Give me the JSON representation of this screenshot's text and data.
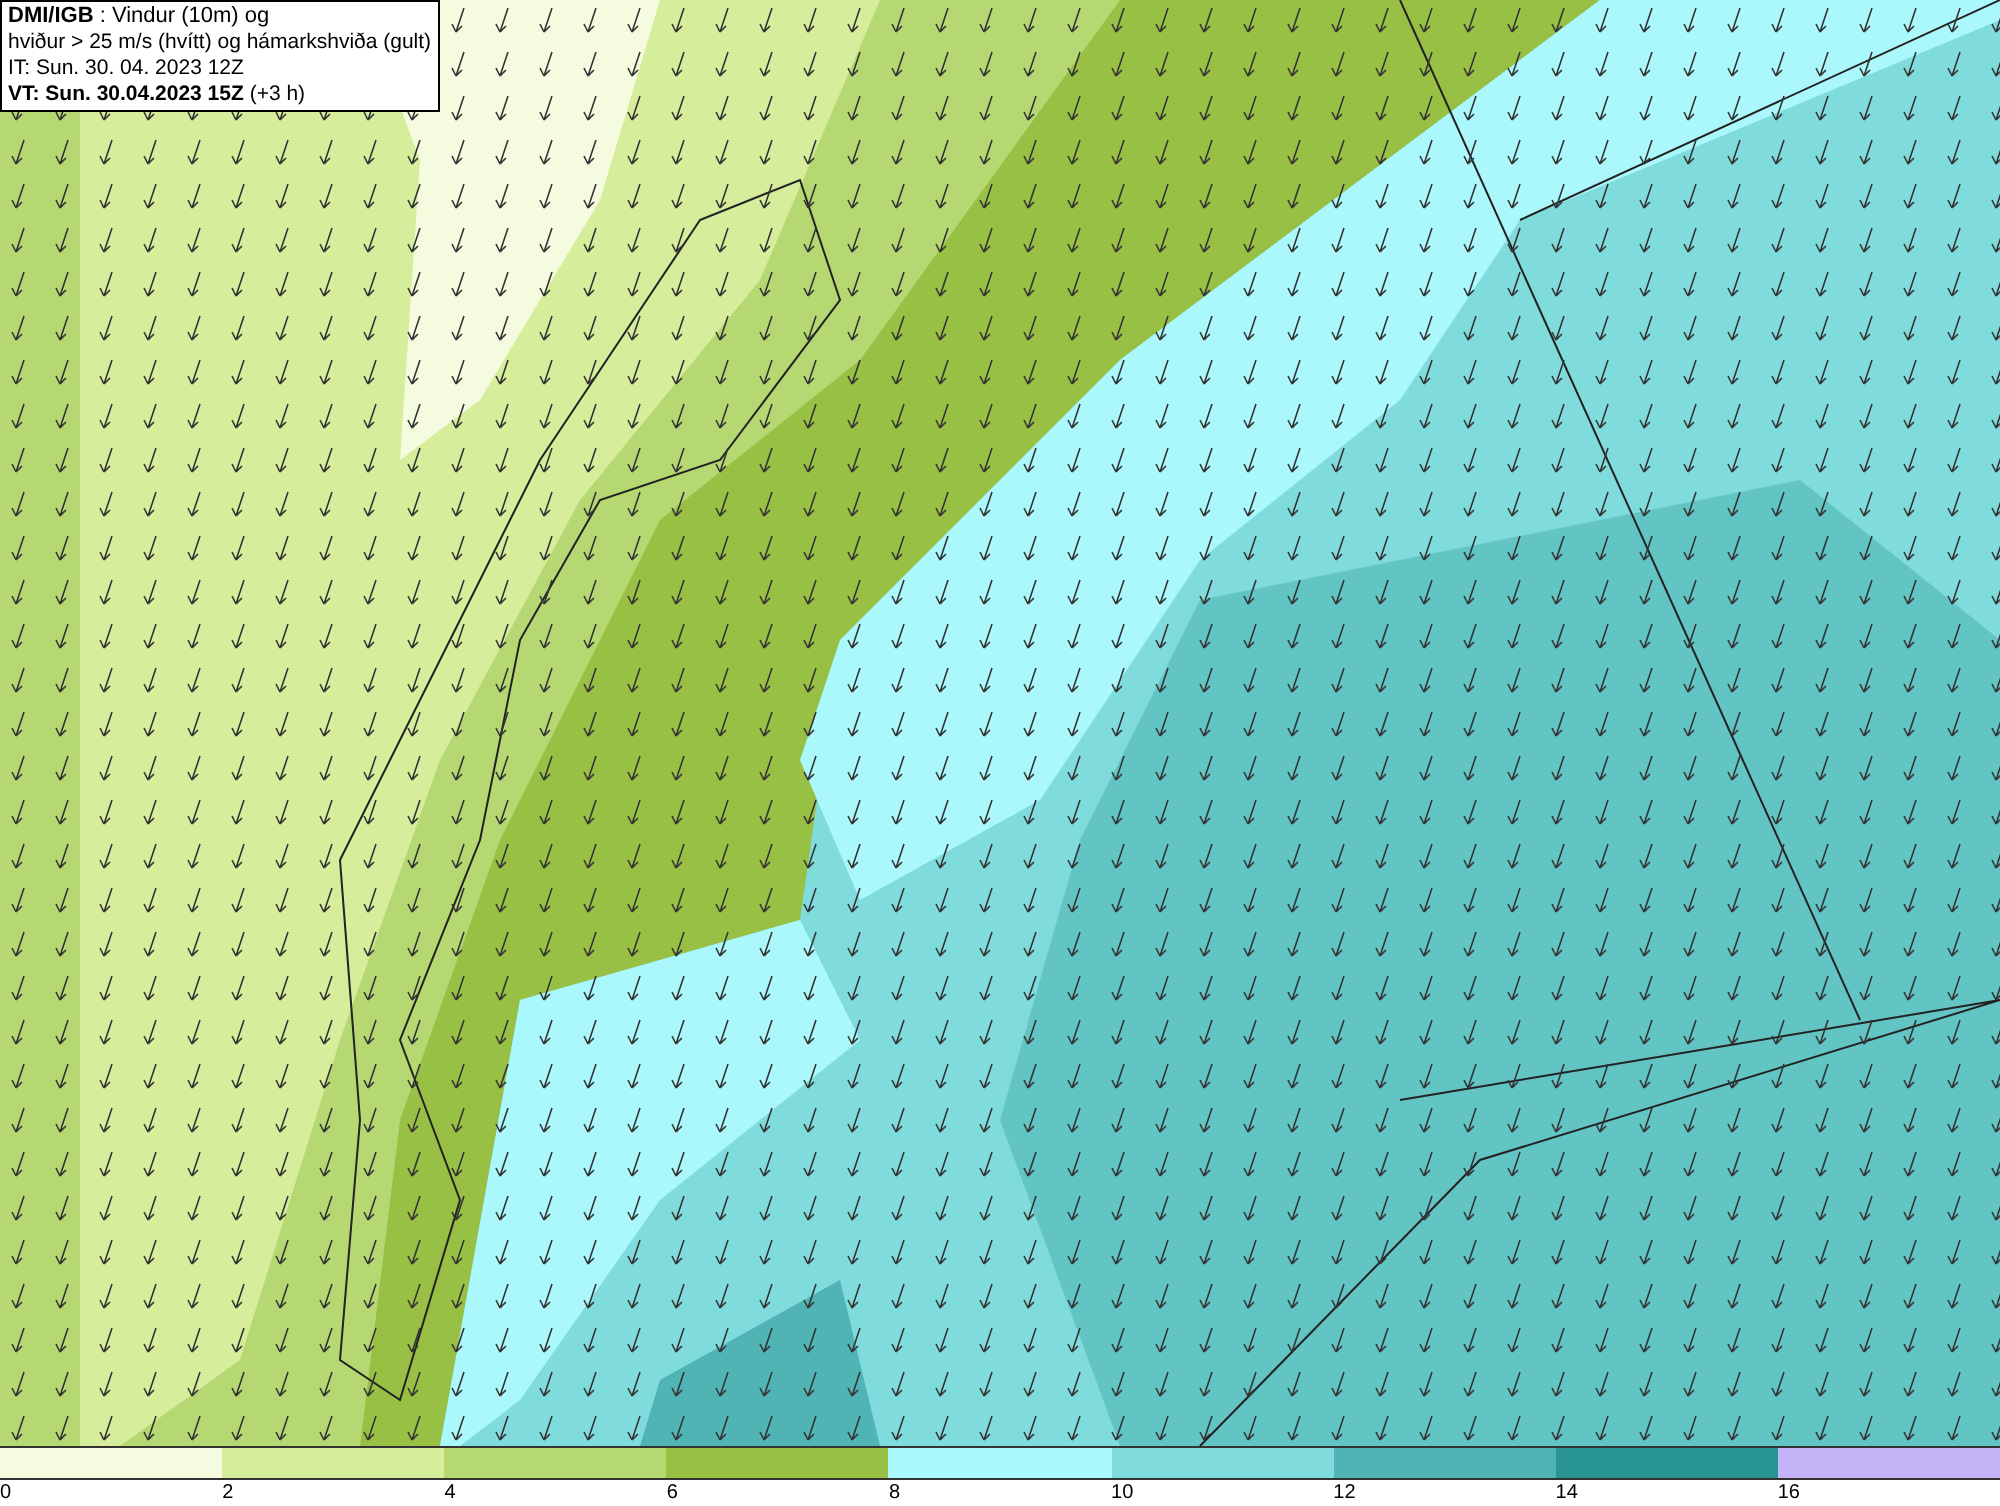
{
  "header": {
    "lines": [
      "**DMI/IGB** : Vindur (10m) og",
      "hviður > 25 m/s (hvítt) og hámarkshviða (gult)",
      "IT: Sun. 30. 04. 2023 12Z",
      "**VT: Sun. 30.04.2023 15Z** (+3 h)"
    ]
  },
  "legend": [
    {
      "label": "0",
      "color": "#f5fbdf"
    },
    {
      "label": "2",
      "color": "#d6ee9c"
    },
    {
      "label": "4",
      "color": "#b6d872"
    },
    {
      "label": "6",
      "color": "#98c044"
    },
    {
      "label": "8",
      "color": "#aaf8fc"
    },
    {
      "label": "10",
      "color": "#80dcdc"
    },
    {
      "label": "12",
      "color": "#50b4b4"
    },
    {
      "label": "14",
      "color": "#289494"
    },
    {
      "label": "16",
      "color": "#c6b4f8"
    }
  ]
}
